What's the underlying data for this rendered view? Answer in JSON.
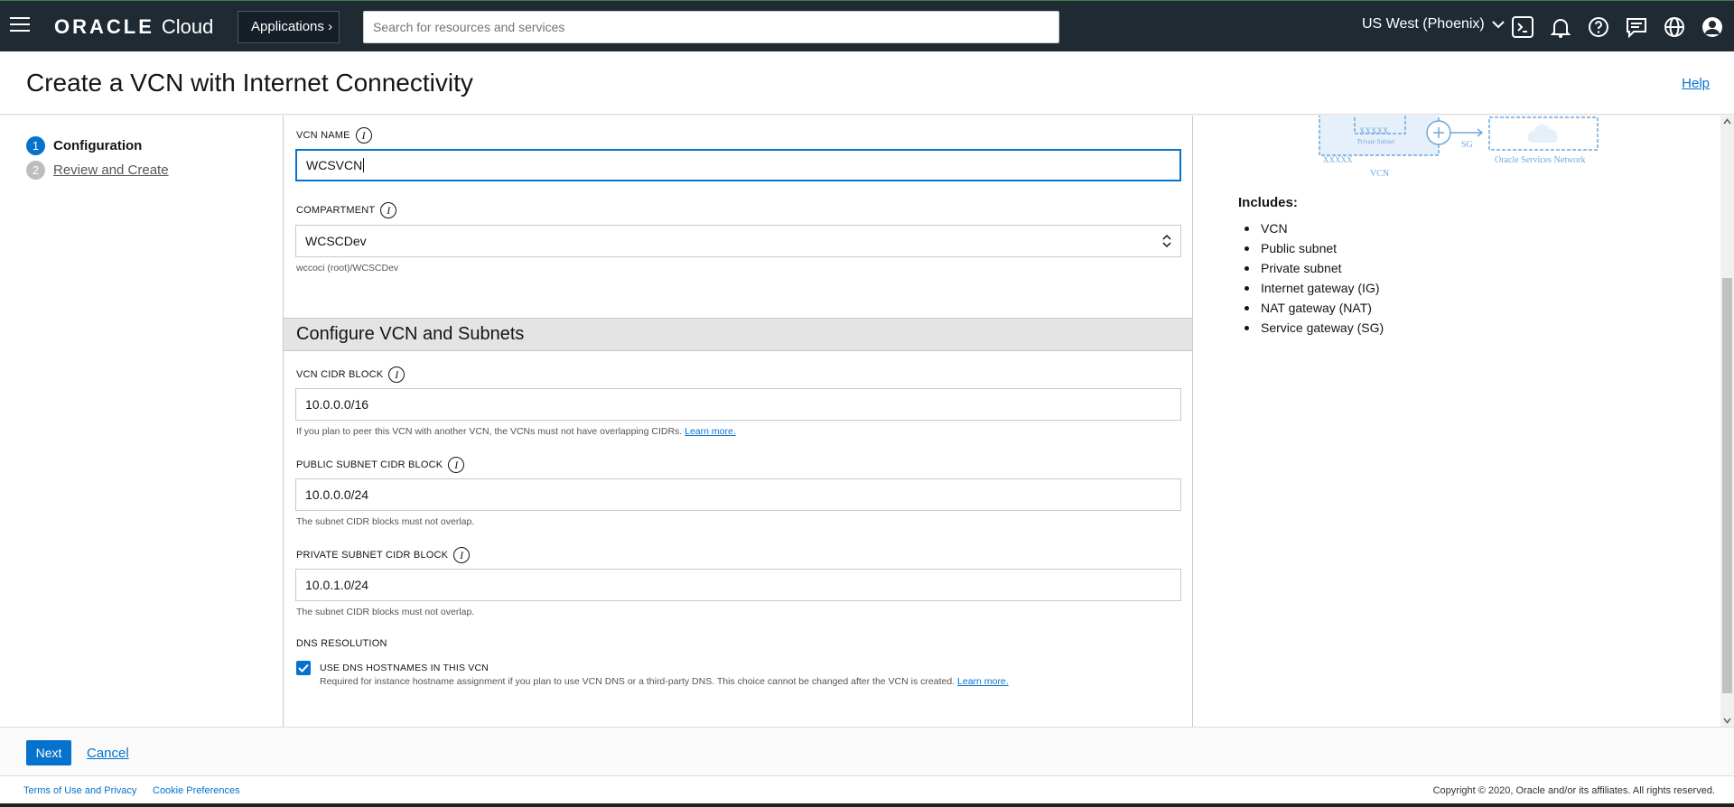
{
  "nav": {
    "logo_oracle": "ORACLE",
    "logo_cloud": "Cloud",
    "applications_label": "Applications",
    "search_placeholder": "Search for resources and services",
    "region": "US West (Phoenix)"
  },
  "header": {
    "title": "Create a VCN with Internet Connectivity",
    "help": "Help"
  },
  "steps": [
    {
      "num": "1",
      "label": "Configuration"
    },
    {
      "num": "2",
      "label": "Review and Create"
    }
  ],
  "basic": {
    "vcn_name_label": "VCN NAME",
    "vcn_name_value": "WCSVCN",
    "compartment_label": "COMPARTMENT",
    "compartment_value": "WCSCDev",
    "compartment_path": "wccoci (root)/WCSCDev"
  },
  "vcn_section": {
    "title": "Configure VCN and Subnets",
    "vcn_cidr_label": "VCN CIDR BLOCK",
    "vcn_cidr_value": "10.0.0.0/16",
    "vcn_cidr_help": "If you plan to peer this VCN with another VCN, the VCNs must not have overlapping CIDRs.",
    "learn_more": "Learn more.",
    "public_cidr_label": "PUBLIC SUBNET CIDR BLOCK",
    "public_cidr_value": "10.0.0.0/24",
    "public_cidr_help": "The subnet CIDR blocks must not overlap.",
    "private_cidr_label": "PRIVATE SUBNET CIDR BLOCK",
    "private_cidr_value": "10.0.1.0/24",
    "private_cidr_help": "The subnet CIDR blocks must not overlap.",
    "dns_label": "DNS RESOLUTION",
    "dns_checkbox_label": "USE DNS HOSTNAMES IN THIS VCN",
    "dns_help": "Required for instance hostname assignment if you plan to use VCN DNS or a third-party DNS. This choice cannot be changed after the VCN is created.",
    "dns_checked": true
  },
  "diagram": {
    "xxxxx_top": "XXXXX",
    "private_subnet": "Private Subnet",
    "xxxxx_bottom": "XXXXX",
    "vcn": "VCN",
    "sg": "SG",
    "oracle_services": "Oracle Services Network"
  },
  "includes": {
    "title": "Includes:",
    "items": [
      "VCN",
      "Public subnet",
      "Private subnet",
      "Internet gateway (IG)",
      "NAT gateway (NAT)",
      "Service gateway (SG)"
    ]
  },
  "actions": {
    "next": "Next",
    "cancel": "Cancel"
  },
  "footer": {
    "terms": "Terms of Use and Privacy",
    "cookies": "Cookie Preferences",
    "copyright": "Copyright © 2020, Oracle and/or its affiliates. All rights reserved."
  },
  "colors": {
    "nav_bg": "#1f2a33",
    "accent": "#0572ce"
  }
}
